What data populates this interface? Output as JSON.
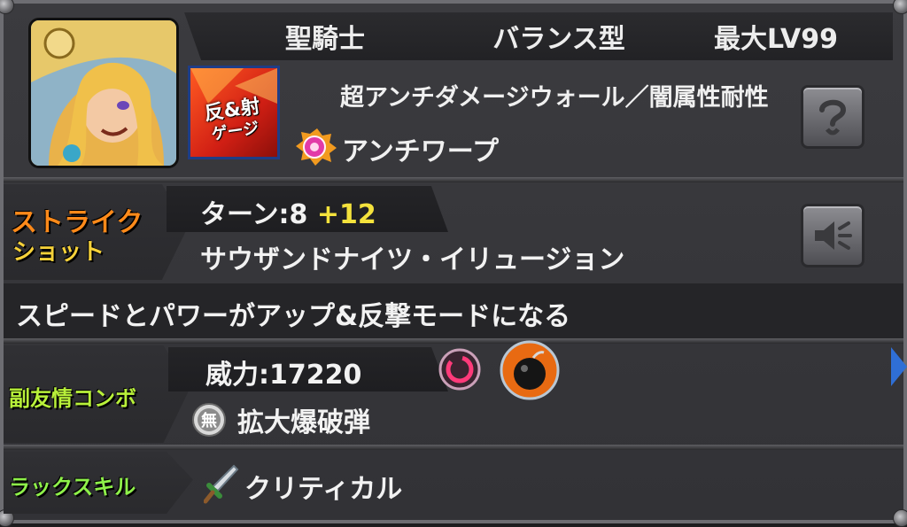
{
  "header": {
    "tab_class": "聖騎士",
    "tab_type": "バランス型",
    "tab_level": "最大LV99"
  },
  "gauge": {
    "line1": "反&射",
    "line2": "ゲージ"
  },
  "abilities": {
    "main": "超アンチダメージウォール／闇属性耐性",
    "sub": "アンチワープ"
  },
  "strike_shot": {
    "label_line1": "ストライク",
    "label_line2": "ショット",
    "turn_label": "ターン:8",
    "turn_bonus": "+12",
    "name": "サウザンドナイツ・イリュージョン",
    "description": "スピードとパワーがアップ&反撃モードになる"
  },
  "sub_friendship": {
    "label": "副友情コンボ",
    "power": "威力:17220",
    "name": "拡大爆破弾",
    "badge": "無"
  },
  "luck_skill": {
    "label": "ラックスキル",
    "name": "クリティカル"
  },
  "colors": {
    "strike_label": "#ff8a1a",
    "strike_label_line2": "#f6d23a",
    "friendship_label": "#b8f03a",
    "luck_label": "#8ef04a",
    "turn_bonus": "#f4e23c"
  },
  "icons": {
    "help": "question-icon",
    "sound": "speaker-icon",
    "next": "next-arrow-icon"
  }
}
